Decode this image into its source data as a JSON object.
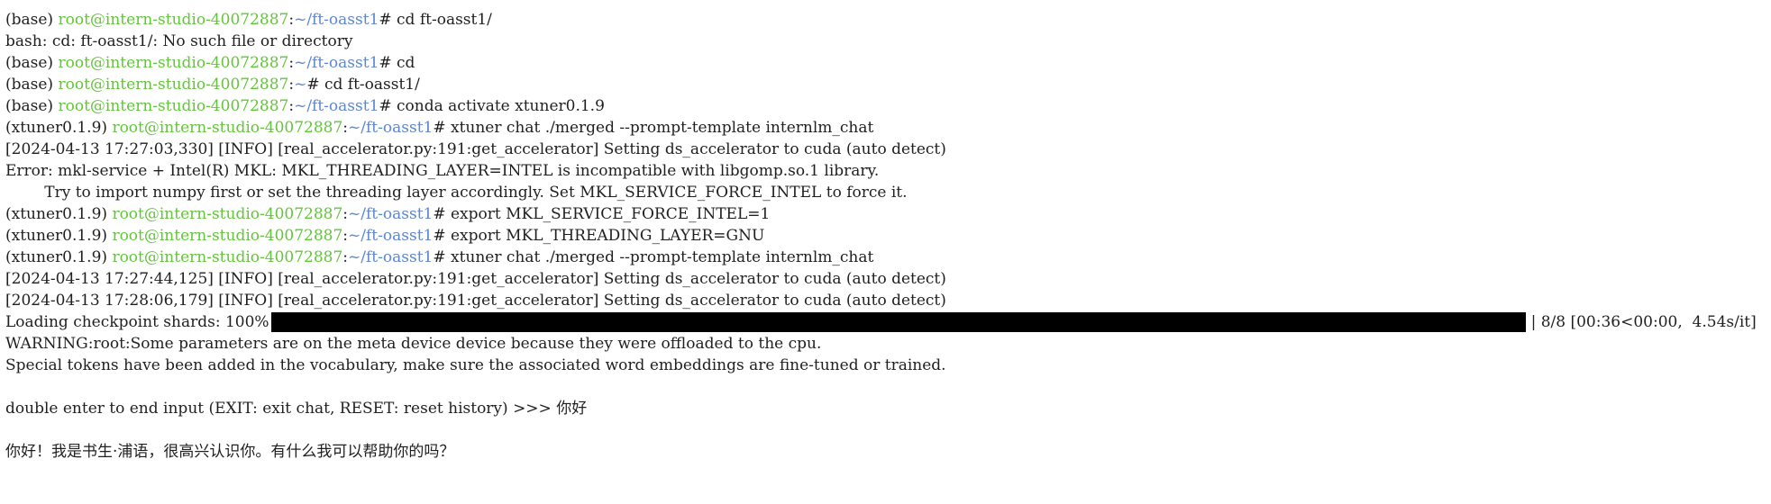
{
  "terminal": {
    "lines": [
      {
        "env": "(base) ",
        "user": "root@intern-studio-40072887",
        "sep": ":",
        "path": "~/ft-oasst1",
        "cmd": "# cd ft-oasst1/"
      },
      {
        "text": "bash: cd: ft-oasst1/: No such file or directory"
      },
      {
        "env": "(base) ",
        "user": "root@intern-studio-40072887",
        "sep": ":",
        "path": "~/ft-oasst1",
        "cmd": "# cd"
      },
      {
        "env": "(base) ",
        "user": "root@intern-studio-40072887",
        "sep": ":",
        "path": "~",
        "cmd": "# cd ft-oasst1/"
      },
      {
        "env": "(base) ",
        "user": "root@intern-studio-40072887",
        "sep": ":",
        "path": "~/ft-oasst1",
        "cmd": "# conda activate xtuner0.1.9"
      },
      {
        "env": "(xtuner0.1.9) ",
        "user": "root@intern-studio-40072887",
        "sep": ":",
        "path": "~/ft-oasst1",
        "cmd": "# xtuner chat ./merged --prompt-template internlm_chat"
      },
      {
        "text": "[2024-04-13 17:27:03,330] [INFO] [real_accelerator.py:191:get_accelerator] Setting ds_accelerator to cuda (auto detect)"
      },
      {
        "text": "Error: mkl-service + Intel(R) MKL: MKL_THREADING_LAYER=INTEL is incompatible with libgomp.so.1 library."
      },
      {
        "text": "        Try to import numpy first or set the threading layer accordingly. Set MKL_SERVICE_FORCE_INTEL to force it."
      },
      {
        "env": "(xtuner0.1.9) ",
        "user": "root@intern-studio-40072887",
        "sep": ":",
        "path": "~/ft-oasst1",
        "cmd": "# export MKL_SERVICE_FORCE_INTEL=1"
      },
      {
        "env": "(xtuner0.1.9) ",
        "user": "root@intern-studio-40072887",
        "sep": ":",
        "path": "~/ft-oasst1",
        "cmd": "# export MKL_THREADING_LAYER=GNU"
      },
      {
        "env": "(xtuner0.1.9) ",
        "user": "root@intern-studio-40072887",
        "sep": ":",
        "path": "~/ft-oasst1",
        "cmd": "# xtuner chat ./merged --prompt-template internlm_chat"
      },
      {
        "text": "[2024-04-13 17:27:44,125] [INFO] [real_accelerator.py:191:get_accelerator] Setting ds_accelerator to cuda (auto detect)"
      },
      {
        "text": "[2024-04-13 17:28:06,179] [INFO] [real_accelerator.py:191:get_accelerator] Setting ds_accelerator to cuda (auto detect)"
      }
    ],
    "progress": {
      "prefix": "Loading checkpoint shards: 100%",
      "suffix": "| 8/8 [00:36<00:00,  4.54s/it]",
      "fraction": 1.0
    },
    "after_progress": [
      "WARNING:root:Some parameters are on the meta device device because they were offloaded to the cpu.",
      "Special tokens have been added in the vocabulary, make sure the associated word embeddings are fine-tuned or trained."
    ],
    "chat_prompt": "double enter to end input (EXIT: exit chat, RESET: reset history) >>> 你好",
    "chat_response": "你好！我是书生·浦语，很高兴认识你。有什么我可以帮助你的吗？"
  },
  "colors": {
    "background": "#ffffff",
    "text": "#1f1f1f",
    "user": "#63c53a",
    "path": "#5d86cf",
    "progress_fill": "#000000"
  }
}
